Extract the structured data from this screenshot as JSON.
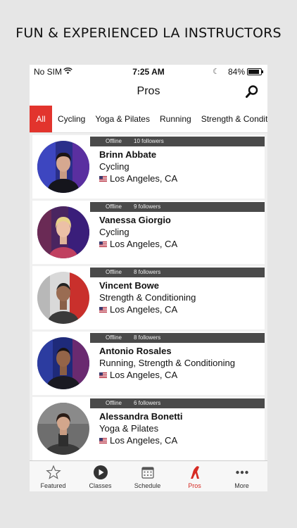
{
  "headline": "FUN & EXPERIENCED LA INSTRUCTORS",
  "status_bar": {
    "carrier": "No SIM",
    "time": "7:25 AM",
    "battery": "84%"
  },
  "nav": {
    "title": "Pros"
  },
  "categories": [
    "All",
    "Cycling",
    "Yoga & Pilates",
    "Running",
    "Strength & Conditioning"
  ],
  "instructors": [
    {
      "status": "Offline",
      "followers": "10 followers",
      "name": "Brinn Abbate",
      "specialty": "Cycling",
      "location": "Los Angeles, CA"
    },
    {
      "status": "Offline",
      "followers": "9 followers",
      "name": "Vanessa Giorgio",
      "specialty": "Cycling",
      "location": "Los Angeles, CA"
    },
    {
      "status": "Offline",
      "followers": "8 followers",
      "name": "Vincent Bowe",
      "specialty": "Strength & Conditioning",
      "location": "Los Angeles,  CA"
    },
    {
      "status": "Offline",
      "followers": "8 followers",
      "name": "Antonio Rosales",
      "specialty": "Running, Strength & Conditioning",
      "location": "Los Angeles, CA"
    },
    {
      "status": "Offline",
      "followers": "6 followers",
      "name": "Alessandra Bonetti",
      "specialty": "Yoga & Pilates",
      "location": "Los Angeles, CA"
    }
  ],
  "tab_bar": {
    "items": [
      {
        "label": "Featured",
        "icon": "star-icon"
      },
      {
        "label": "Classes",
        "icon": "play-icon"
      },
      {
        "label": "Schedule",
        "icon": "calendar-icon"
      },
      {
        "label": "Pros",
        "icon": "pros-icon"
      },
      {
        "label": "More",
        "icon": "more-icon"
      }
    ],
    "active": "Pros"
  },
  "colors": {
    "accent": "#e2342d",
    "status_strip": "#4a4a4a"
  }
}
